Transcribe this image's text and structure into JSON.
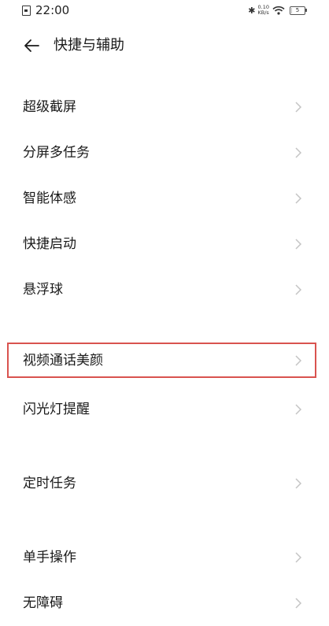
{
  "status_bar": {
    "time": "22:00",
    "network_speed_value": "0.10",
    "network_speed_unit": "KB/s",
    "battery_level": "5",
    "battery_fraction": 0.05
  },
  "header": {
    "title": "快捷与辅助"
  },
  "colors": {
    "highlight_border": "#d9534f",
    "chevron": "#c4c4c4",
    "text": "#1a1a1a"
  },
  "items": [
    {
      "label": "超级截屏"
    },
    {
      "label": "分屏多任务"
    },
    {
      "label": "智能体感"
    },
    {
      "label": "快捷启动"
    },
    {
      "label": "悬浮球"
    },
    {
      "label": "视频通话美颜",
      "highlighted": true
    },
    {
      "label": "闪光灯提醒"
    },
    {
      "label": "定时任务"
    },
    {
      "label": "单手操作"
    },
    {
      "label": "无障碍"
    }
  ],
  "icons": {
    "back": "arrow-left-icon",
    "chevron": "chevron-right-icon",
    "sim": "sim-card-icon",
    "bluetooth": "bluetooth-icon",
    "wifi": "wifi-icon",
    "battery": "battery-icon"
  }
}
